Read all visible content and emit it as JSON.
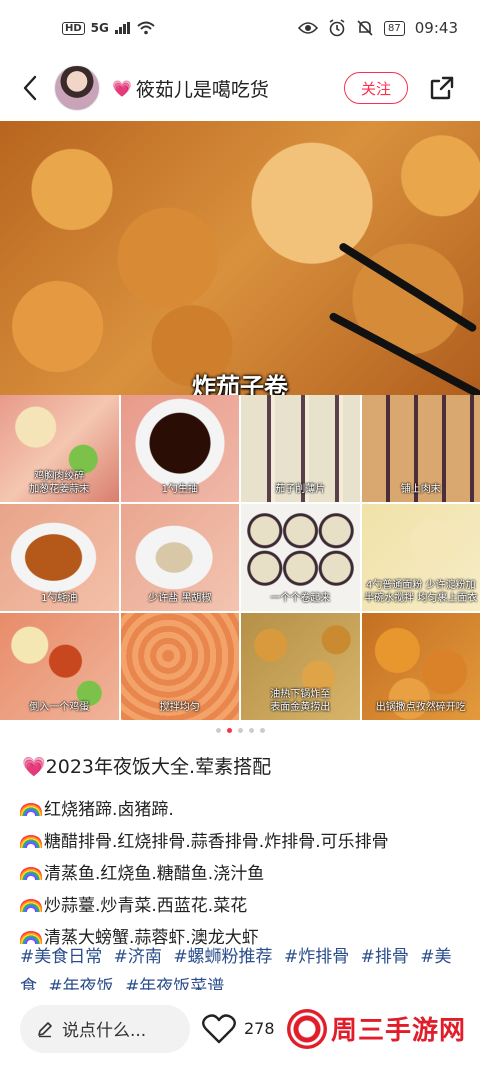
{
  "status_bar": {
    "network": "HD",
    "signal": "5G",
    "battery": "87",
    "time": "09:43"
  },
  "header": {
    "author_heart": "💗",
    "author_name": "筱茹儿是噶吃货",
    "follow_label": "关注"
  },
  "image": {
    "caption": "炸茄子卷",
    "steps": [
      {
        "label": "鸡胸肉绞碎\n加葱花姜蒜末",
        "kind": "meat"
      },
      {
        "label": "1勺生抽",
        "kind": "sauce"
      },
      {
        "label": "茄子削薄片",
        "kind": "slices"
      },
      {
        "label": "铺上肉末",
        "kind": "spread"
      },
      {
        "label": "1勺蚝油",
        "kind": "egg"
      },
      {
        "label": "少许盐 黑胡椒",
        "kind": "salt"
      },
      {
        "label": "一个个卷起来",
        "kind": "rolls"
      },
      {
        "label": "4勺普通面粉 少许淀粉加\n半碗水搅拌 均匀裹上面衣",
        "kind": "batter"
      },
      {
        "label": "倒入一个鸡蛋",
        "kind": "mix1"
      },
      {
        "label": "搅拌均匀",
        "kind": "mix2"
      },
      {
        "label": "油热下锅炸至\n表面金黄捞出",
        "kind": "fry"
      },
      {
        "label": "出锅撒点孜然碎开吃",
        "kind": "done"
      }
    ],
    "page_count": 5,
    "active_page": 2
  },
  "post": {
    "title_emoji": "💗",
    "title": "2023年夜饭大全.荤素搭配",
    "lines": [
      "红烧猪蹄.卤猪蹄.",
      "糖醋排骨.红烧排骨.蒜香排骨.炸排骨.可乐排骨",
      "清蒸鱼.红烧鱼.糖醋鱼.浇汁鱼",
      "炒蒜薹.炒青菜.西蓝花.菜花",
      "清蒸大螃蟹.蒜蓉虾.澳龙大虾"
    ],
    "tags": [
      "#美食日常",
      "#济南",
      "#螺蛳粉推荐",
      "#炸排骨",
      "#排骨",
      "#美食",
      "#年夜饭",
      "#年夜饭菜谱"
    ]
  },
  "bottom_bar": {
    "comment_placeholder": "说点什么...",
    "like_count": "278"
  },
  "watermark": {
    "text": "周三手游网"
  },
  "colors": {
    "accent": "#ff2e4d",
    "tag": "#2b4e8c",
    "watermark": "#e11d2a"
  }
}
